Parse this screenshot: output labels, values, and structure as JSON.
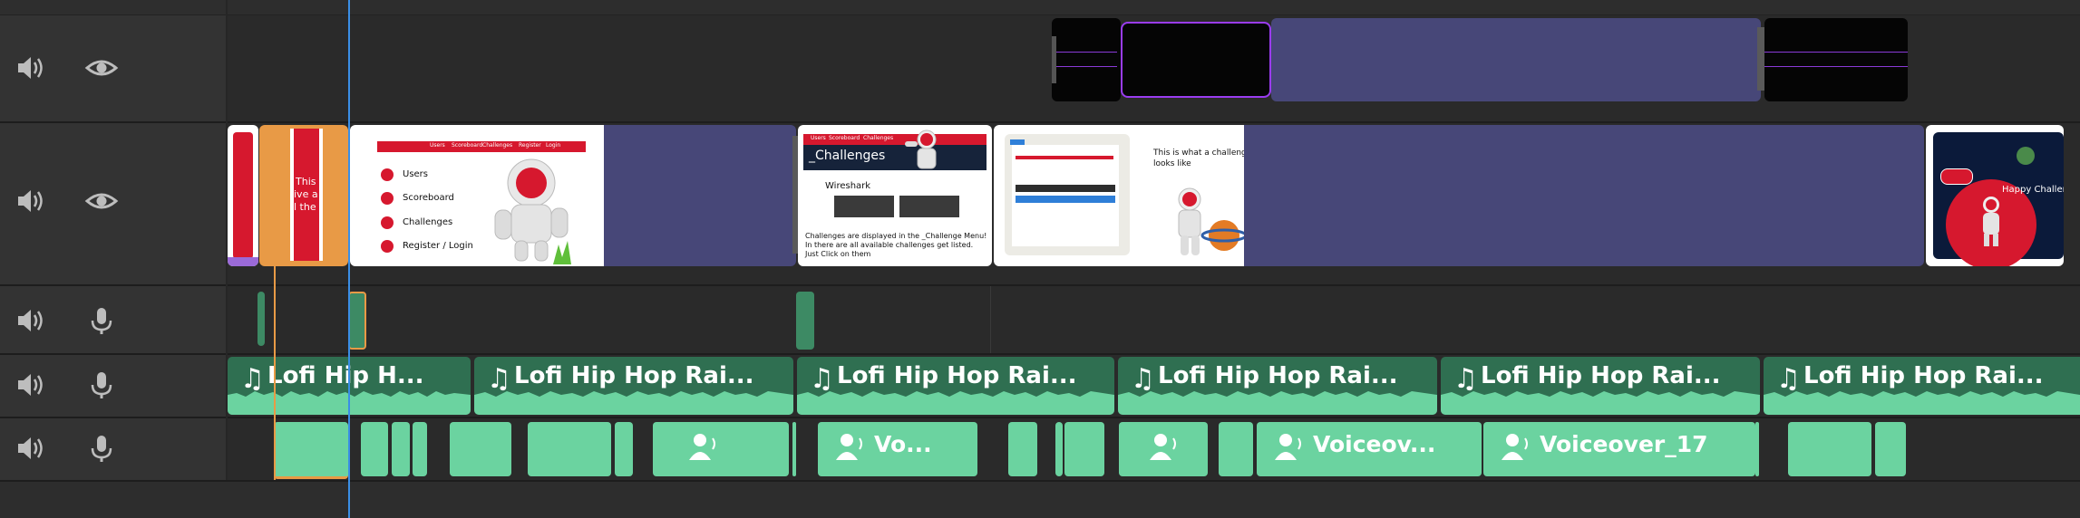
{
  "colors": {
    "background": "#2b2b2b",
    "header": "#333333",
    "lane": "#2a2a2a",
    "placeholder_purple": "#474778",
    "selected_orange": "#e89a46",
    "playhead_blue": "#3a8ee6",
    "audio_green": "#6bd3a0",
    "audio_dark_green": "#3d8a64",
    "accent_red": "#d6182e",
    "selection_purple": "#9a3cf0"
  },
  "tracks": [
    {
      "kind": "video",
      "icons": [
        "speaker-icon",
        "eye-icon"
      ]
    },
    {
      "kind": "video",
      "icons": [
        "speaker-icon",
        "eye-icon"
      ]
    },
    {
      "kind": "audio",
      "icons": [
        "speaker-icon",
        "microphone-icon"
      ]
    },
    {
      "kind": "audio",
      "icons": [
        "speaker-icon",
        "microphone-icon"
      ]
    },
    {
      "kind": "audio",
      "icons": [
        "speaker-icon",
        "microphone-icon"
      ]
    }
  ],
  "music_clips": [
    {
      "label": "Lofi Hip H..."
    },
    {
      "label": "Lofi Hip Hop Rai..."
    },
    {
      "label": "Lofi Hip Hop Rai..."
    },
    {
      "label": "Lofi Hip Hop Rai..."
    },
    {
      "label": "Lofi Hip Hop Rai..."
    },
    {
      "label": "Lofi Hip Hop Rai..."
    }
  ],
  "voiceover_clips": [
    {
      "label": "Vo..."
    },
    {
      "label": "Voiceov..."
    },
    {
      "label": "Voiceover_17"
    }
  ],
  "thumbnails": {
    "selected_clip_text": [
      "This",
      "ive a",
      "l the"
    ],
    "menu": {
      "items": [
        "Users",
        "Scoreboard",
        "Challenges",
        "Register / Login"
      ],
      "nav": [
        "Users",
        "Scoreboard",
        "Challenges",
        "Register",
        "Login"
      ]
    },
    "challenges": {
      "nav": [
        "Users",
        "Scoreboard",
        "Challenges"
      ],
      "heading": "_Challenges",
      "subheading": "Wireshark",
      "caption_1": "Challenges are displayed in the _Challenge Menu!",
      "caption_2": "In there are all available challenges get listed.",
      "caption_3": "Just Click on them"
    },
    "challenge_view": {
      "caption_1": "This is what a challenge",
      "caption_2": "looks like"
    },
    "last": {
      "caption": "Happy Challen"
    }
  }
}
